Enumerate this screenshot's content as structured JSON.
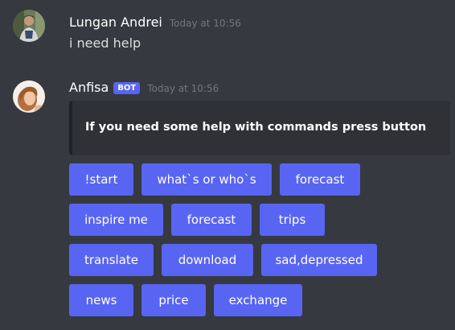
{
  "messages": [
    {
      "username": "Lungan Andrei",
      "timestamp": "Today at 10:56",
      "content": "i need help"
    },
    {
      "username": "Anfisa",
      "bot_tag": "BOT",
      "timestamp": "Today at 10:56",
      "embed_description": "If you need some help with commands press button",
      "buttons": [
        "!start",
        "what`s or who`s",
        "forecast",
        "inspire me",
        "forecast",
        "trips",
        "translate",
        "download",
        "sad,depressed",
        "news",
        "price",
        "exchange"
      ]
    }
  ],
  "colors": {
    "background": "#36393f",
    "blurple": "#5865f2",
    "embed_bg": "#2f3136",
    "timestamp": "#72767d"
  }
}
